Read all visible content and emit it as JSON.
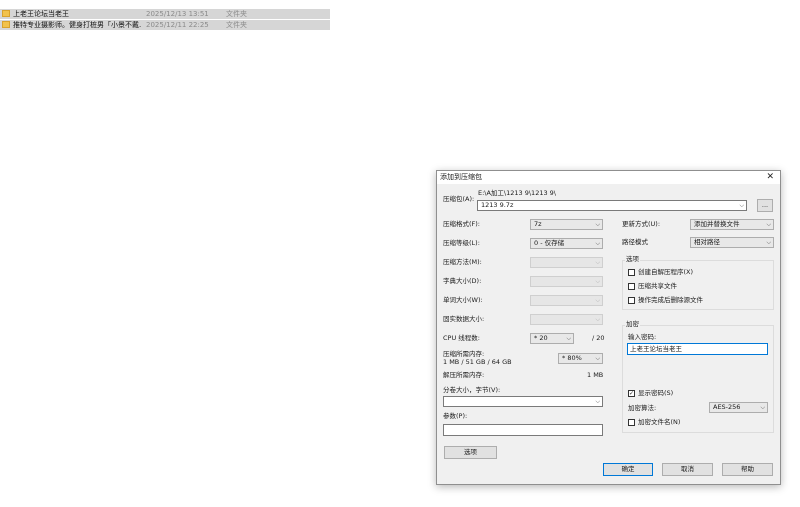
{
  "files": [
    {
      "name": "上老王论坛当老王",
      "date": "2025/12/13 13:51",
      "type": "文件夹"
    },
    {
      "name": "推特专业摄影师。健身打桩男「小景不戴...",
      "date": "2025/12/11 22:25",
      "type": "文件夹"
    }
  ],
  "dialog": {
    "title": "添加到压缩包",
    "close": "✕",
    "archive_label": "压缩包(A):",
    "archive_path": "E:\\A加工\\1213 9\\1213 9\\",
    "archive_name": "1213 9.7z",
    "browse": "...",
    "format_label": "压缩格式(F):",
    "format_value": "7z",
    "level_label": "压缩等级(L):",
    "level_value": "0 - 仅存储",
    "method_label": "压缩方法(M):",
    "dict_label": "字典大小(D):",
    "word_label": "单词大小(W):",
    "solid_label": "固实数据大小:",
    "cpu_label": "CPU 线程数:",
    "cpu_value": "* 20",
    "cpu_total": "/ 20",
    "mem_label": "压缩所需内存:",
    "mem_detail": "1 MB / 51 GB / 64 GB",
    "mem_value": "* 80%",
    "decomp_label": "解压所需内存:",
    "decomp_value": "1 MB",
    "split_label": "分卷大小，字节(V):",
    "params_label": "参数(P):",
    "options_button": "选项",
    "update_label": "更新方式(U):",
    "update_value": "添加并替换文件",
    "path_label": "路径模式",
    "path_value": "相对路径",
    "options_group": "选项",
    "opt_sfx": "创建自解压程序(X)",
    "opt_shared": "压缩共享文件",
    "opt_delete": "操作完成后删除源文件",
    "encrypt_group": "加密",
    "password_label": "输入密码:",
    "password_value": "上老王论坛当老王",
    "show_password": "显示密码(S)",
    "show_password_check": "✓",
    "enc_method_label": "加密算法:",
    "enc_method_value": "AES-256",
    "encrypt_names": "加密文件名(N)",
    "ok": "确定",
    "cancel": "取消",
    "help": "帮助",
    "dropdown_arrow": "⌵"
  }
}
